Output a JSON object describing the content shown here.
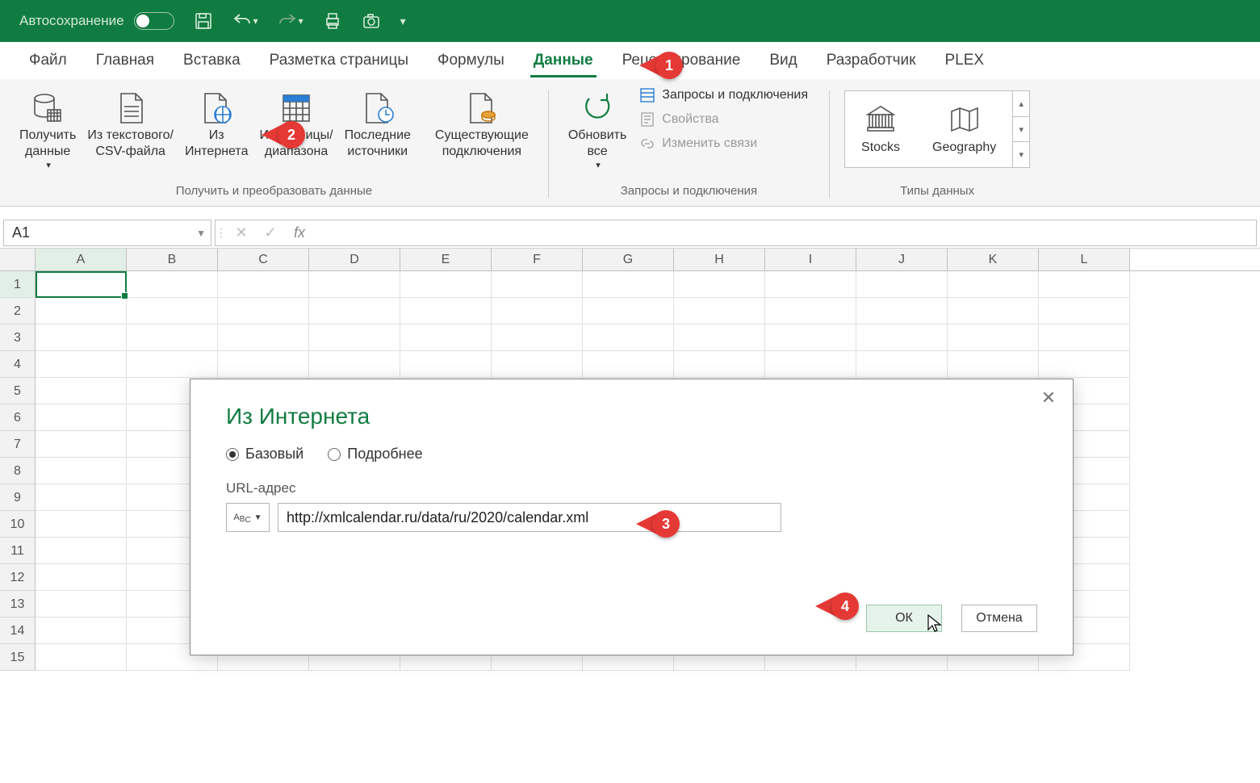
{
  "titlebar": {
    "autosave": "Автосохранение"
  },
  "tabs": [
    "Файл",
    "Главная",
    "Вставка",
    "Разметка страницы",
    "Формулы",
    "Данные",
    "Рецензирование",
    "Вид",
    "Разработчик",
    "PLEX"
  ],
  "active_tab": "Данные",
  "ribbon": {
    "group1": {
      "get_data": "Получить\nданные",
      "from_csv": "Из текстового/\nCSV-файла",
      "from_web": "Из\nИнтернета",
      "from_table": "Из таблицы/\nдиапазона",
      "recent": "Последние\nисточники",
      "existing": "Существующие\nподключения",
      "label": "Получить и преобразовать данные"
    },
    "group2": {
      "refresh": "Обновить\nвсе",
      "queries": "Запросы и подключения",
      "props": "Свойства",
      "editlinks": "Изменить связи",
      "label": "Запросы и подключения"
    },
    "group3": {
      "stocks": "Stocks",
      "geography": "Geography",
      "label": "Типы данных"
    }
  },
  "namebox": "A1",
  "columns": [
    "A",
    "B",
    "C",
    "D",
    "E",
    "F",
    "G",
    "H",
    "I",
    "J",
    "K",
    "L"
  ],
  "rows": [
    "1",
    "2",
    "3",
    "4",
    "5",
    "6",
    "7",
    "8",
    "9",
    "10",
    "11",
    "12",
    "13",
    "14",
    "15"
  ],
  "dialog": {
    "title": "Из Интернета",
    "radio_basic": "Базовый",
    "radio_advanced": "Подробнее",
    "url_label": "URL-адрес",
    "type_btn": "ABC",
    "url_value": "http://xmlcalendar.ru/data/ru/2020/calendar.xml",
    "ok": "ОК",
    "cancel": "Отмена"
  },
  "callouts": {
    "c1": "1",
    "c2": "2",
    "c3": "3",
    "c4": "4"
  }
}
